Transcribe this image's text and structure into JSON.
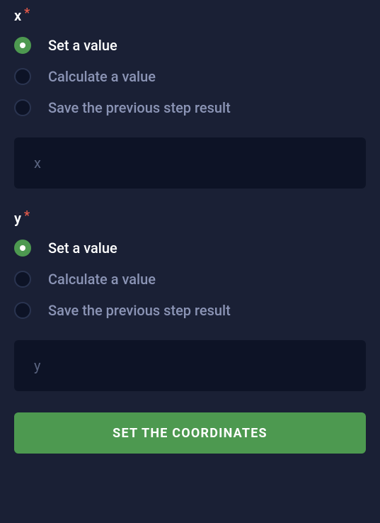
{
  "fields": {
    "x": {
      "label": "x",
      "required_mark": "*",
      "options": {
        "set": "Set a value",
        "calculate": "Calculate a value",
        "save": "Save the previous step result"
      },
      "selected": "set",
      "input_placeholder": "x",
      "input_value": ""
    },
    "y": {
      "label": "y",
      "required_mark": "*",
      "options": {
        "set": "Set a value",
        "calculate": "Calculate a value",
        "save": "Save the previous step result"
      },
      "selected": "set",
      "input_placeholder": "y",
      "input_value": ""
    }
  },
  "submit_button_label": "SET THE COORDINATES"
}
